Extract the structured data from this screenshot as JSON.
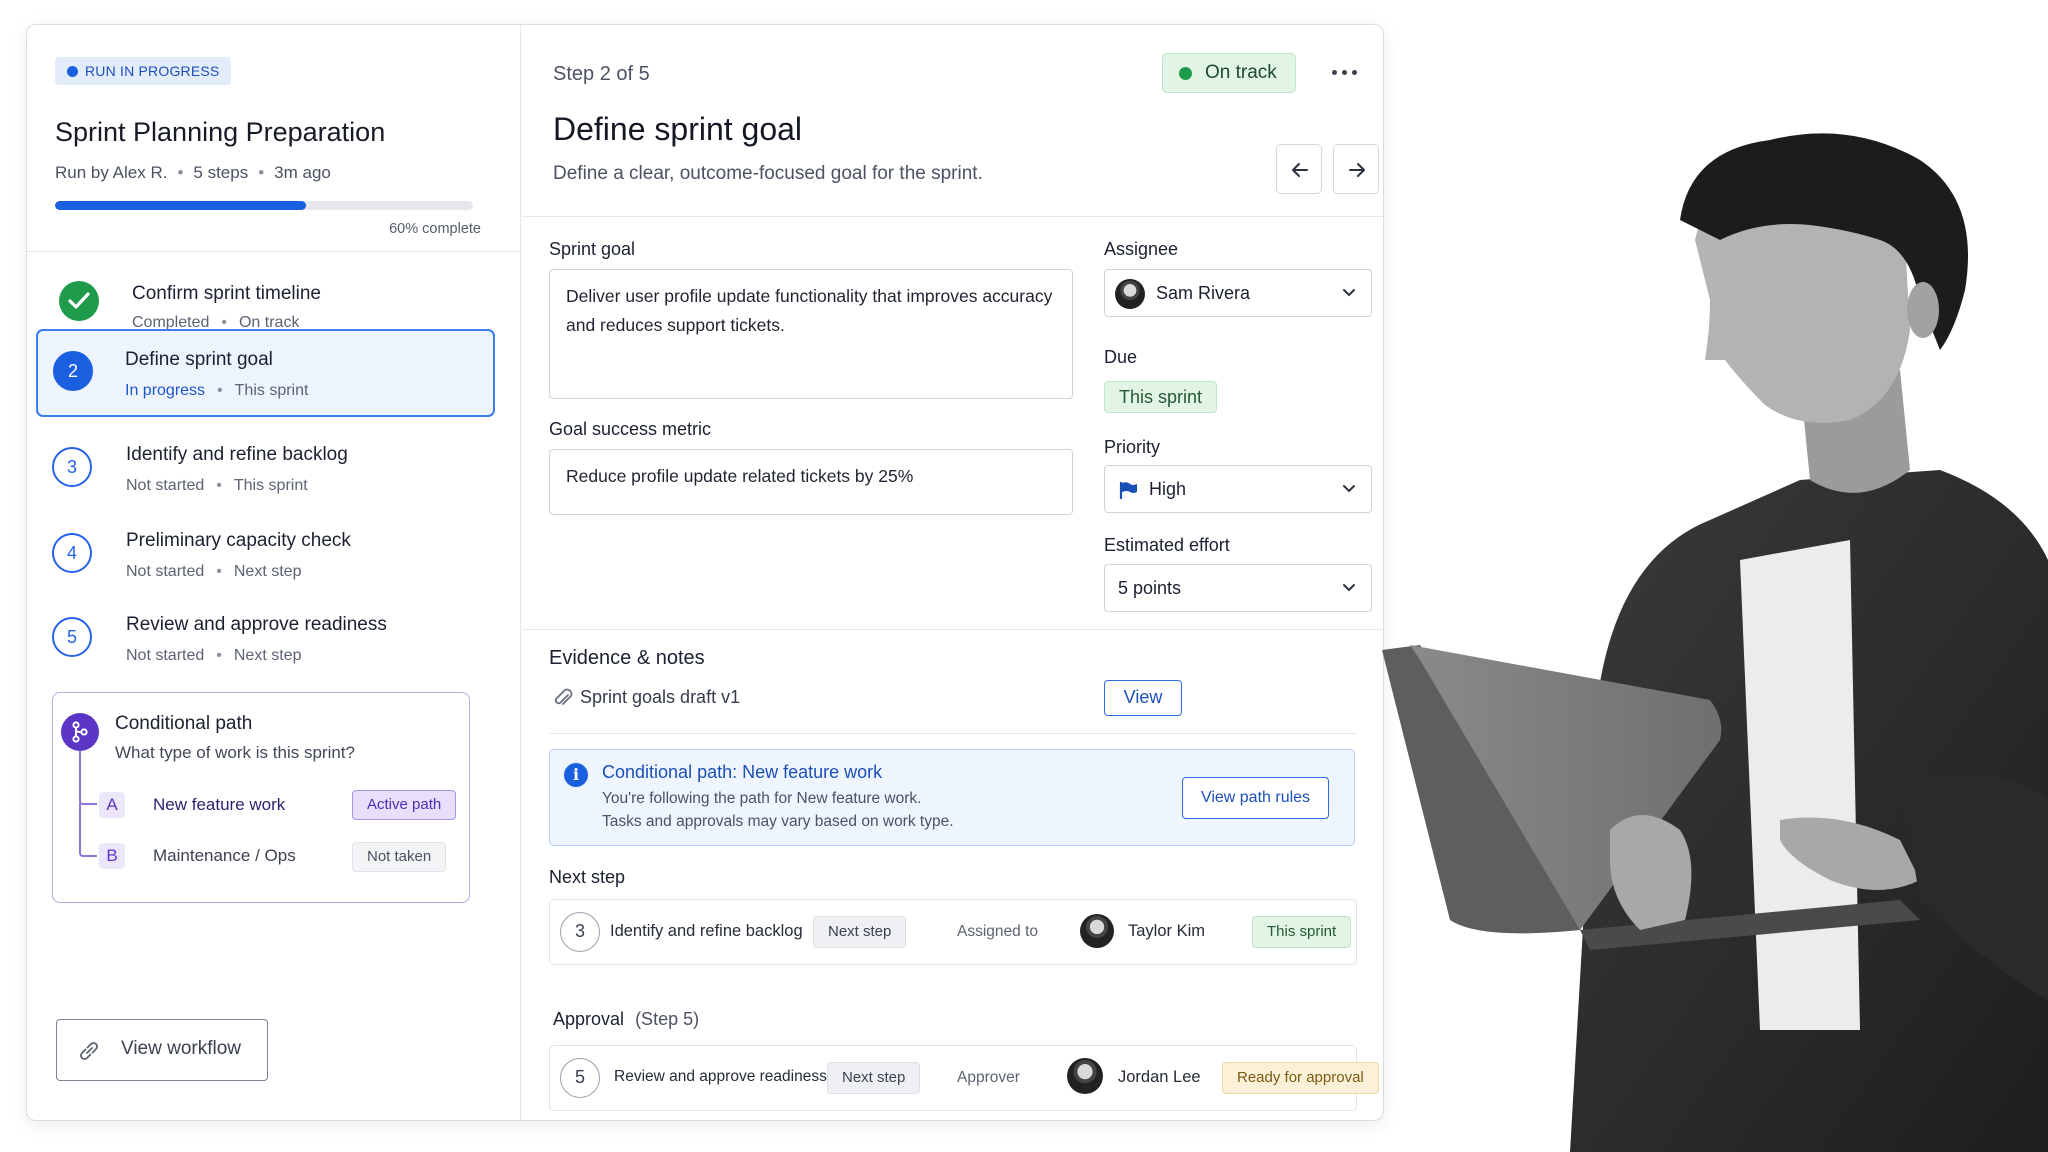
{
  "run": {
    "badge": "RUN IN PROGRESS",
    "title": "Sprint Planning Preparation",
    "run_by": "Run by Alex R.",
    "steps_count": "5 steps",
    "time_ago": "3m ago",
    "progress_fraction": 0.6,
    "progress_label": "60% complete"
  },
  "steps": [
    {
      "number": "",
      "title": "Confirm sprint timeline",
      "status": "Completed",
      "timing": "On track",
      "state": "completed"
    },
    {
      "number": "2",
      "title": "Define sprint goal",
      "status": "In progress",
      "timing": "This sprint",
      "state": "active"
    },
    {
      "number": "3",
      "title": "Identify and refine backlog",
      "status": "Not started",
      "timing": "This sprint",
      "state": "pending"
    },
    {
      "number": "4",
      "title": "Preliminary capacity check",
      "status": "Not started",
      "timing": "Next step",
      "state": "pending"
    },
    {
      "number": "5",
      "title": "Review and approve readiness",
      "status": "Not started",
      "timing": "Next step",
      "state": "pending"
    }
  ],
  "conditional": {
    "title": "Conditional path",
    "question": "What type of work is this sprint?",
    "options": [
      {
        "letter": "A",
        "label": "New feature work",
        "chip": "Active path"
      },
      {
        "letter": "B",
        "label": "Maintenance / Ops",
        "chip": "Not taken"
      }
    ]
  },
  "view_workflow": "View workflow",
  "detail": {
    "step_count": "Step 2 of 5",
    "status": "On track",
    "title": "Define sprint goal",
    "description": "Define a clear, outcome-focused goal for the sprint.",
    "sprint_goal_label": "Sprint goal",
    "sprint_goal_value": "Deliver user profile update functionality that improves accuracy and reduces support tickets.",
    "metric_label": "Goal success metric",
    "metric_value": "Reduce profile update related tickets by 25%",
    "assignee_label": "Assignee",
    "assignee_value": "Sam Rivera",
    "due_label": "Due",
    "due_value": "This sprint",
    "priority_label": "Priority",
    "priority_value": "High",
    "effort_label": "Estimated effort",
    "effort_value": "5 points"
  },
  "evidence": {
    "title": "Evidence & notes",
    "file": "Sprint goals draft v1",
    "view_label": "View"
  },
  "info": {
    "title": "Conditional path: New feature work",
    "line1": "You're following the path for New feature work.",
    "line2": "Tasks and approvals may vary based on work type.",
    "button": "View path rules"
  },
  "next_step": {
    "label": "Next step",
    "number": "3",
    "title": "Identify and refine backlog",
    "chip": "Next step",
    "assigned_label": "Assigned to",
    "person": "Taylor Kim",
    "timing": "This sprint"
  },
  "approval": {
    "label": "Approval",
    "label_suffix": "(Step 5)",
    "number": "5",
    "title": "Review and approve readiness",
    "chip": "Next step",
    "approver_label": "Approver",
    "person": "Jordan Lee",
    "status": "Ready for approval"
  },
  "colors": {
    "accent": "#1a5fe0",
    "success": "#1f9b4c",
    "conditional": "#5b36c4",
    "warning_bg": "#fbf1d9"
  }
}
